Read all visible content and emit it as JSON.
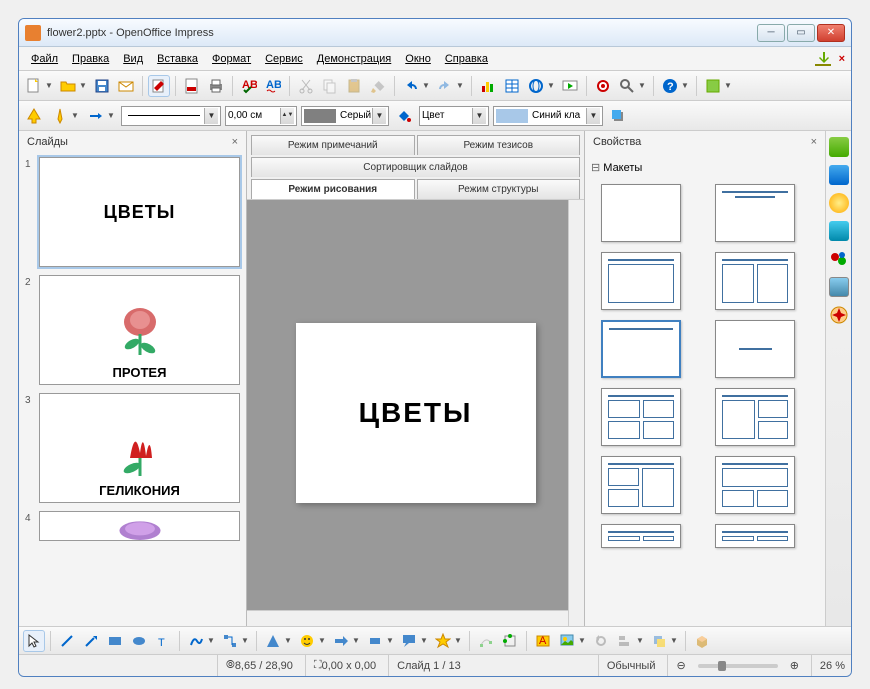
{
  "window": {
    "title": "flower2.pptx - OpenOffice Impress"
  },
  "menu": {
    "file": "Файл",
    "edit": "Правка",
    "view": "Вид",
    "insert": "Вставка",
    "format": "Формат",
    "tools": "Сервис",
    "slideshow": "Демонстрация",
    "window": "Окно",
    "help": "Справка"
  },
  "toolbar2": {
    "linewidth": "0,00 см",
    "colorname": "Серый",
    "fillmode": "Цвет",
    "fillcolor": "Синий кла"
  },
  "slides": {
    "title": "Слайды",
    "items": [
      {
        "n": "1",
        "caption": "ЦВЕТЫ",
        "kind": "title"
      },
      {
        "n": "2",
        "caption": "ПРОТЕЯ",
        "kind": "flower",
        "color": "#d86b6b"
      },
      {
        "n": "3",
        "caption": "ГЕЛИКОНИЯ",
        "kind": "flower",
        "color": "#d02020"
      },
      {
        "n": "4",
        "caption": "",
        "kind": "flower",
        "color": "#b080d0"
      }
    ]
  },
  "tabs": {
    "notes": "Режим примечаний",
    "handout": "Режим тезисов",
    "sorter": "Сортировщик слайдов",
    "drawing": "Режим рисования",
    "outline": "Режим структуры"
  },
  "main_slide": {
    "text": "ЦВЕТЫ"
  },
  "properties": {
    "title": "Свойства",
    "layouts": "Макеты"
  },
  "status": {
    "pos": "8,65 / 28,90",
    "size": "0,00 x 0,00",
    "slide": "Слайд 1 / 13",
    "mode": "Обычный",
    "zoom": "26 %"
  }
}
